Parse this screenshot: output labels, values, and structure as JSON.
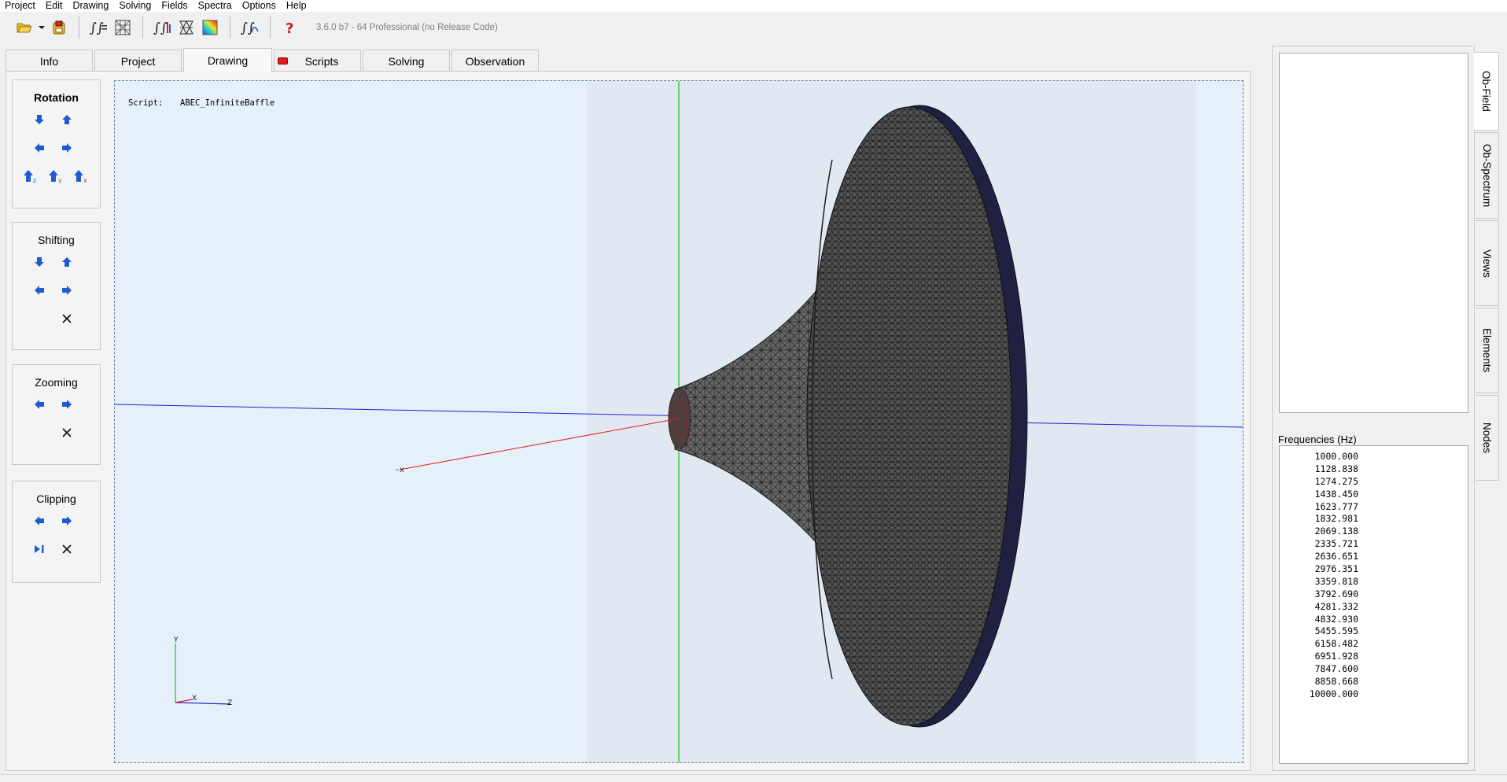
{
  "menu": [
    "Project",
    "Edit",
    "Drawing",
    "Solving",
    "Fields",
    "Spectra",
    "Options",
    "Help"
  ],
  "toolbar": {
    "version": "3.6.0 b7 - 64 Professional (no Release Code)",
    "icons": [
      "folder-open-icon",
      "dropdown-arrow-icon",
      "save-disk-icon",
      "solve-integral-icon",
      "mesh-grid-icon",
      "field-integral-icon",
      "mesh-view-icon",
      "color-spectrum-icon",
      "spectrum-integral-icon",
      "help-question-icon"
    ]
  },
  "tabs": [
    {
      "label": "Info",
      "active": false
    },
    {
      "label": "Project",
      "active": false
    },
    {
      "label": "Drawing",
      "active": true
    },
    {
      "label": "Scripts",
      "active": false,
      "indicator_color": "#e41b1b"
    },
    {
      "label": "Solving",
      "active": false
    },
    {
      "label": "Observation",
      "active": false
    }
  ],
  "tool_groups": {
    "rotation": {
      "title": "Rotation",
      "axis_labels": [
        "z",
        "y",
        "x"
      ]
    },
    "shifting": {
      "title": "Shifting"
    },
    "zooming": {
      "title": "Zooming"
    },
    "clipping": {
      "title": "Clipping"
    }
  },
  "viewport": {
    "script_label": "Script:",
    "script_name": "ABEC_InfiniteBaffle",
    "axis_labels": {
      "y": "Y",
      "x": "X",
      "z": "Z",
      "x_marker": "-x"
    },
    "colors": {
      "axis_x": "#e02020",
      "axis_y": "#18c018",
      "axis_z": "#2020d0",
      "mesh": "#3a3a3a"
    }
  },
  "frequencies": {
    "title": "Frequencies  (Hz)",
    "values": [
      "1000.000",
      "1128.838",
      "1274.275",
      "1438.450",
      "1623.777",
      "1832.981",
      "2069.138",
      "2335.721",
      "2636.651",
      "2976.351",
      "3359.818",
      "3792.690",
      "4281.332",
      "4832.930",
      "5455.595",
      "6158.482",
      "6951.928",
      "7847.600",
      "8858.668",
      "10000.000"
    ]
  },
  "side_tabs": [
    {
      "label": "Ob-Field",
      "active": true
    },
    {
      "label": "Ob-Spectrum",
      "active": false
    },
    {
      "label": "Views",
      "active": false
    },
    {
      "label": "Elements",
      "active": false
    },
    {
      "label": "Nodes",
      "active": false
    }
  ]
}
